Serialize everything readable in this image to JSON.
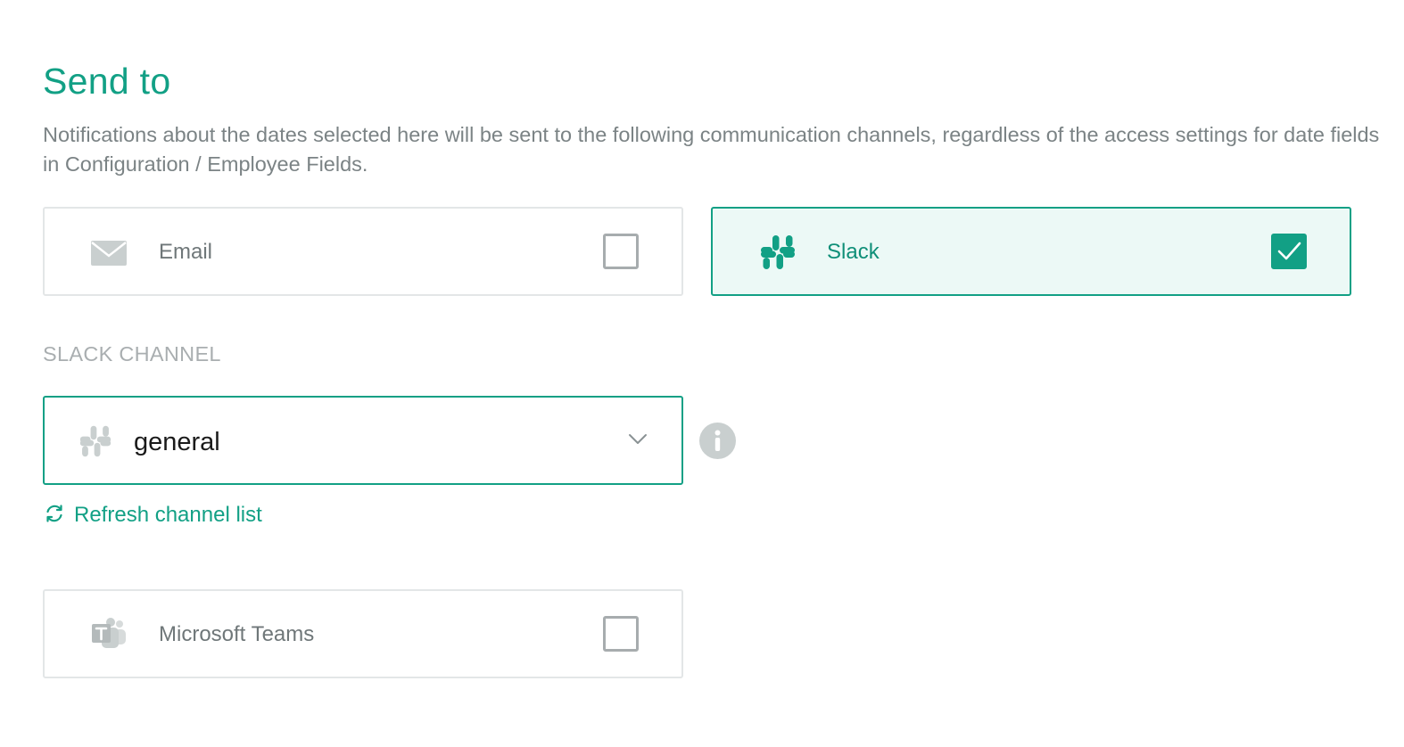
{
  "section": {
    "title": "Send to",
    "description": "Notifications about the dates selected here will be sent to the following communication channels, regardless of the access settings for date fields in Configuration / Employee Fields."
  },
  "channels": [
    {
      "label": "Email",
      "icon": "envelope-icon",
      "checked": false
    },
    {
      "label": "Slack",
      "icon": "slack-icon",
      "checked": true
    },
    {
      "label": "Microsoft Teams",
      "icon": "microsoft-teams-icon",
      "checked": false
    }
  ],
  "slack_channel": {
    "label": "SLACK CHANNEL",
    "selected_value": "general",
    "refresh_label": "Refresh channel list"
  },
  "colors": {
    "accent": "#12a085",
    "selected_background": "#ecf9f6",
    "muted_text": "#7b8385",
    "border": "#e3e6e7"
  }
}
